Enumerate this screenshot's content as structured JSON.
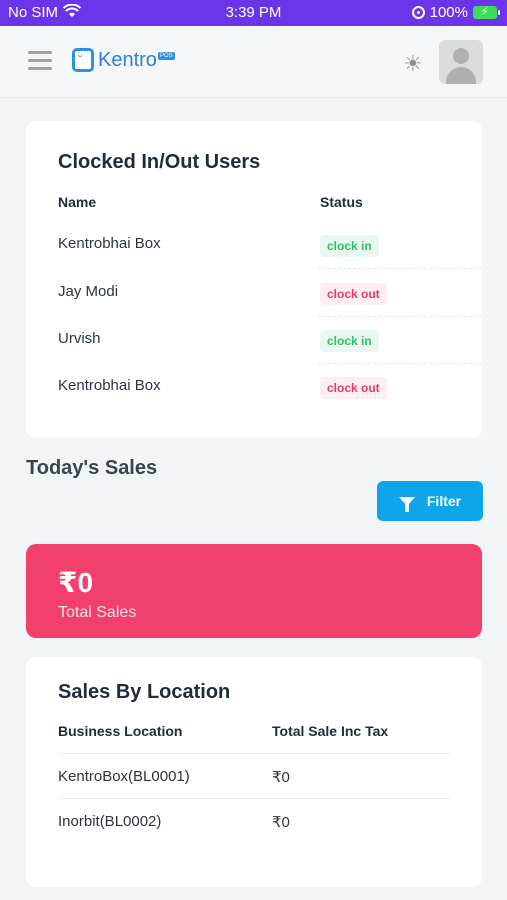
{
  "status_bar": {
    "carrier": "No SIM",
    "time": "3:39 PM",
    "battery": "100%",
    "icons": [
      "wifi-icon",
      "orientation-lock-icon",
      "battery-charging-icon"
    ]
  },
  "header": {
    "logo_text": "Kentro",
    "logo_badge": "POS",
    "icons": [
      "hamburger-menu-icon",
      "sun-icon",
      "avatar-icon"
    ]
  },
  "clocked_card": {
    "title": "Clocked In/Out Users",
    "col_name": "Name",
    "col_status": "Status",
    "rows": [
      {
        "name": "Kentrobhai Box",
        "status": "clock in"
      },
      {
        "name": "Jay Modi",
        "status": "clock out"
      },
      {
        "name": "Urvish",
        "status": "clock in"
      },
      {
        "name": "Kentrobhai Box",
        "status": "clock out"
      }
    ]
  },
  "sales": {
    "heading": "Today's Sales",
    "filter_label": "Filter",
    "total_amount": "₹0",
    "total_label": "Total Sales"
  },
  "location_card": {
    "title": "Sales By Location",
    "col_location": "Business Location",
    "col_total": "Total Sale Inc Tax",
    "rows": [
      {
        "location": "KentroBox(BL0001)",
        "total": "₹0"
      },
      {
        "location": "Inorbit(BL0002)",
        "total": "₹0"
      }
    ]
  },
  "colors": {
    "status_bar": "#6a35e8",
    "total_card": "#f2406c",
    "filter_button": "#0ea5ea",
    "clock_in": "#2fbf6b",
    "clock_out": "#e8386a"
  }
}
